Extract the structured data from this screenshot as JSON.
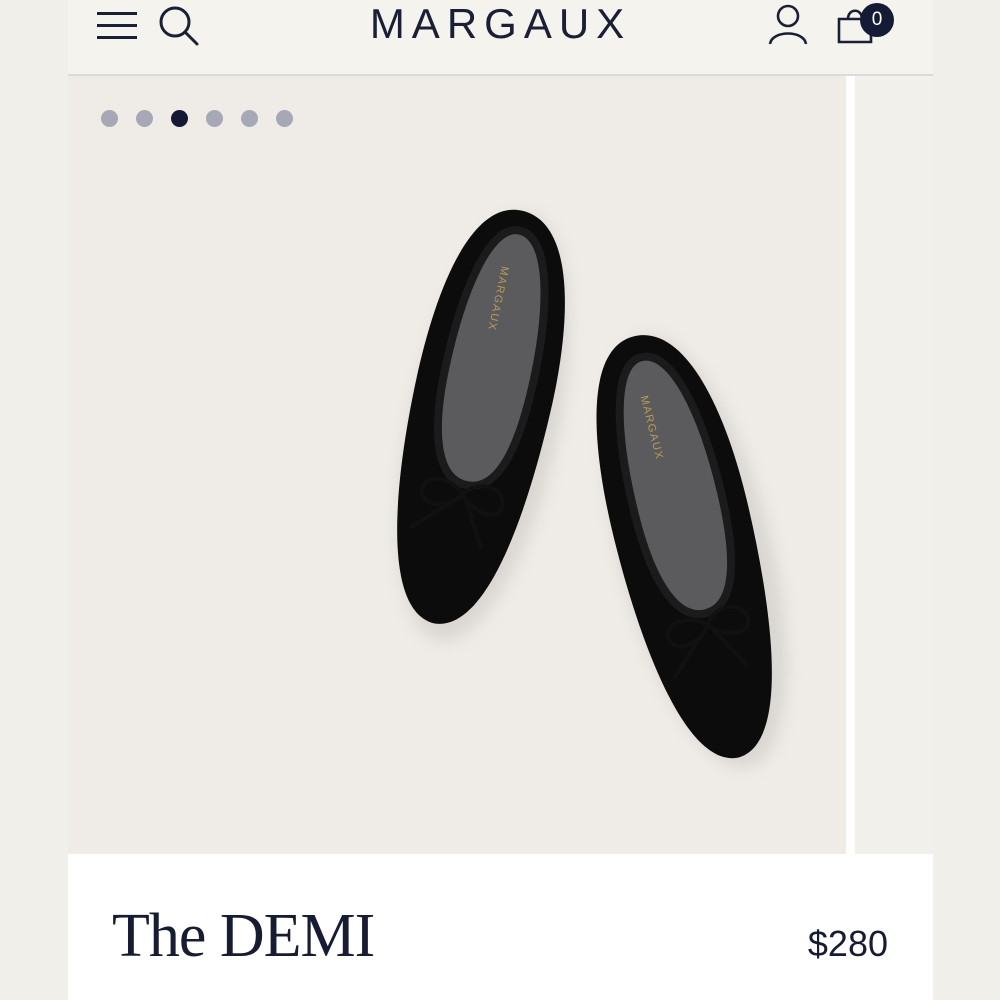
{
  "header": {
    "brand": "MARGAUX",
    "cart_count": "0",
    "icons": [
      "menu-icon",
      "search-icon",
      "account-icon",
      "shopping-bag-icon"
    ]
  },
  "gallery": {
    "slide_count": 6,
    "active_slide": 3,
    "image": "black velvet ballet flats with bow",
    "insole_brand": "MARGAUX"
  },
  "product": {
    "name": "The DEMI",
    "price": "$280"
  },
  "colors": {
    "navy": "#151b34",
    "background": "#f1efea",
    "dot_inactive": "#a6a8b6"
  }
}
